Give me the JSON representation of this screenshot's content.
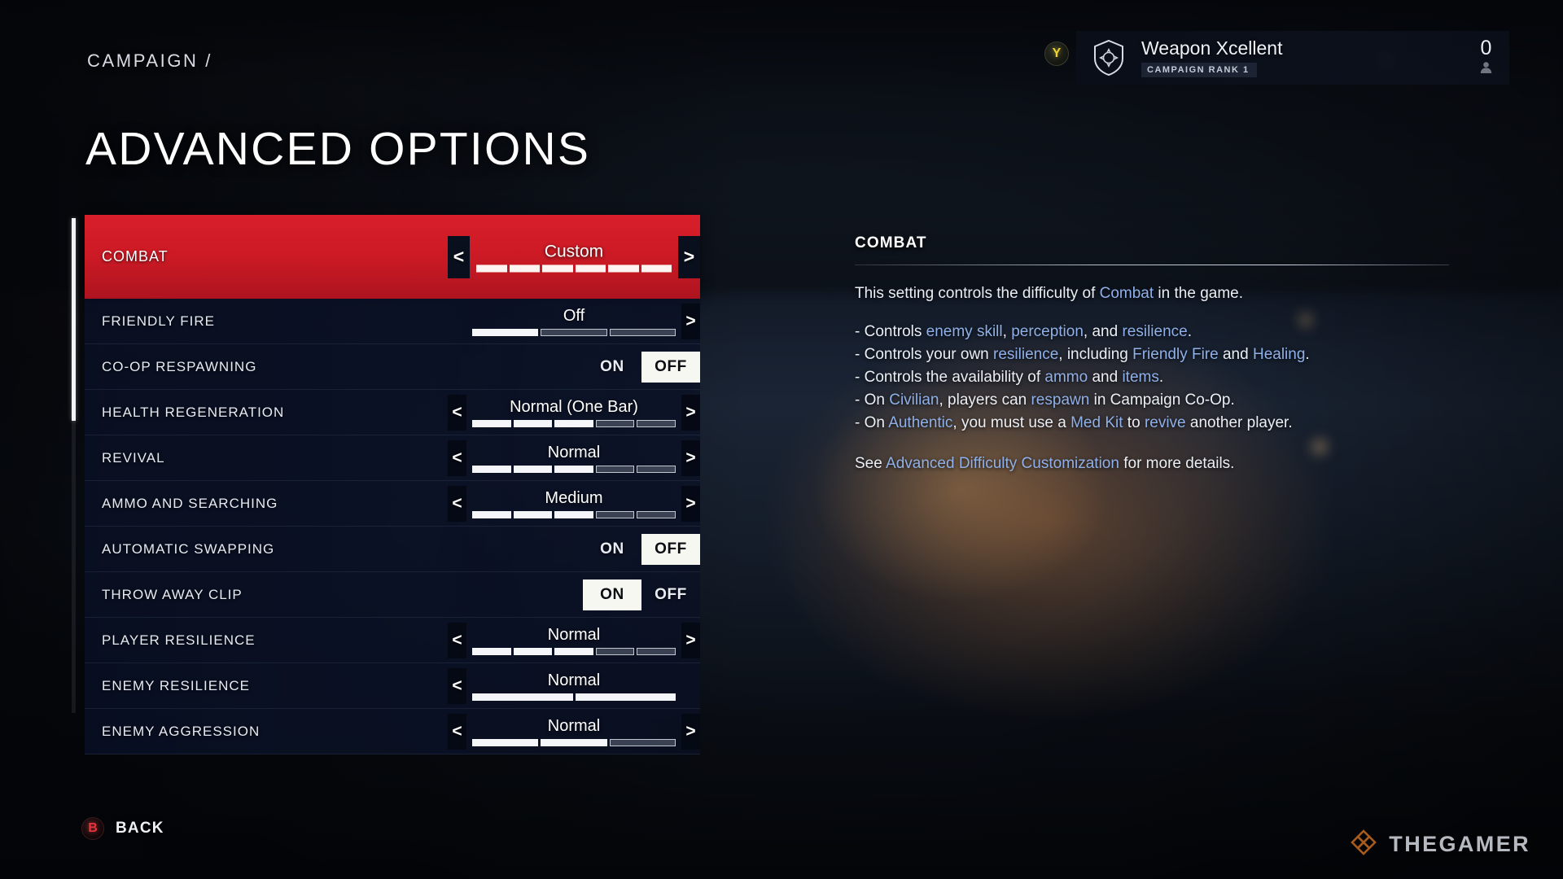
{
  "header": {
    "breadcrumb": "CAMPAIGN /",
    "title": "ADVANCED OPTIONS"
  },
  "player_card": {
    "hint_button": "Y",
    "emblem_icon": "shield-emblem-icon",
    "name": "Weapon Xcellent",
    "rank": "CAMPAIGN RANK 1",
    "count": "0",
    "count_icon": "player-icon"
  },
  "options": {
    "scroll_thumb_pct": 41,
    "rows": [
      {
        "label": "COMBAT",
        "control": "stepper",
        "value": "Custom",
        "segments": 6,
        "filled": 6,
        "left_arrow": "<",
        "right_arrow": ">",
        "show_left": true,
        "show_right": true,
        "selected": true
      },
      {
        "label": "FRIENDLY FIRE",
        "control": "stepper",
        "value": "Off",
        "segments": 3,
        "filled": 1,
        "left_arrow": "<",
        "right_arrow": ">",
        "show_left": false,
        "show_right": true,
        "selected": false
      },
      {
        "label": "CO-OP RESPAWNING",
        "control": "toggle",
        "on_label": "ON",
        "off_label": "OFF",
        "value": "OFF",
        "selected": false
      },
      {
        "label": "HEALTH REGENERATION",
        "control": "stepper",
        "value": "Normal (One Bar)",
        "segments": 5,
        "filled": 3,
        "left_arrow": "<",
        "right_arrow": ">",
        "show_left": true,
        "show_right": true,
        "selected": false
      },
      {
        "label": "REVIVAL",
        "control": "stepper",
        "value": "Normal",
        "segments": 5,
        "filled": 3,
        "left_arrow": "<",
        "right_arrow": ">",
        "show_left": true,
        "show_right": true,
        "selected": false
      },
      {
        "label": "AMMO AND SEARCHING",
        "control": "stepper",
        "value": "Medium",
        "segments": 5,
        "filled": 3,
        "left_arrow": "<",
        "right_arrow": ">",
        "show_left": true,
        "show_right": true,
        "selected": false
      },
      {
        "label": "AUTOMATIC SWAPPING",
        "control": "toggle",
        "on_label": "ON",
        "off_label": "OFF",
        "value": "OFF",
        "selected": false
      },
      {
        "label": "THROW AWAY CLIP",
        "control": "toggle",
        "on_label": "ON",
        "off_label": "OFF",
        "value": "ON",
        "selected": false
      },
      {
        "label": "PLAYER RESILIENCE",
        "control": "stepper",
        "value": "Normal",
        "segments": 5,
        "filled": 3,
        "left_arrow": "<",
        "right_arrow": ">",
        "show_left": true,
        "show_right": true,
        "selected": false
      },
      {
        "label": "ENEMY RESILIENCE",
        "control": "stepper",
        "value": "Normal",
        "segments": 2,
        "filled": 2,
        "left_arrow": "<",
        "right_arrow": ">",
        "show_left": true,
        "show_right": false,
        "selected": false
      },
      {
        "label": "ENEMY AGGRESSION",
        "control": "stepper",
        "value": "Normal",
        "segments": 3,
        "filled": 2,
        "left_arrow": "<",
        "right_arrow": ">",
        "show_left": true,
        "show_right": true,
        "selected": false
      }
    ]
  },
  "info": {
    "title": "COMBAT",
    "intro": [
      {
        "t": "This setting controls the difficulty of ",
        "hl": false
      },
      {
        "t": "Combat",
        "hl": true
      },
      {
        "t": " in the game.",
        "hl": false
      }
    ],
    "bullets": [
      [
        {
          "t": "- Controls ",
          "hl": false
        },
        {
          "t": "enemy skill",
          "hl": true
        },
        {
          "t": ", ",
          "hl": false
        },
        {
          "t": "perception",
          "hl": true
        },
        {
          "t": ", and ",
          "hl": false
        },
        {
          "t": "resilience",
          "hl": true
        },
        {
          "t": ".",
          "hl": false
        }
      ],
      [
        {
          "t": "- Controls your own ",
          "hl": false
        },
        {
          "t": "resilience",
          "hl": true
        },
        {
          "t": ", including ",
          "hl": false
        },
        {
          "t": "Friendly Fire",
          "hl": true
        },
        {
          "t": " and ",
          "hl": false
        },
        {
          "t": "Healing",
          "hl": true
        },
        {
          "t": ".",
          "hl": false
        }
      ],
      [
        {
          "t": "- Controls the availability of ",
          "hl": false
        },
        {
          "t": "ammo",
          "hl": true
        },
        {
          "t": " and ",
          "hl": false
        },
        {
          "t": "items",
          "hl": true
        },
        {
          "t": ".",
          "hl": false
        }
      ],
      [
        {
          "t": "- On ",
          "hl": false
        },
        {
          "t": "Civilian",
          "hl": true
        },
        {
          "t": ", players can ",
          "hl": false
        },
        {
          "t": "respawn",
          "hl": true
        },
        {
          "t": " in Campaign Co-Op.",
          "hl": false
        }
      ],
      [
        {
          "t": "- On ",
          "hl": false
        },
        {
          "t": "Authentic",
          "hl": true
        },
        {
          "t": ", you must use a ",
          "hl": false
        },
        {
          "t": "Med Kit",
          "hl": true
        },
        {
          "t": " to ",
          "hl": false
        },
        {
          "t": "revive",
          "hl": true
        },
        {
          "t": " another player.",
          "hl": false
        }
      ]
    ],
    "footer": [
      {
        "t": "See ",
        "hl": false
      },
      {
        "t": "Advanced Difficulty Customization",
        "hl": true
      },
      {
        "t": " for more details.",
        "hl": false
      }
    ]
  },
  "footer": {
    "back_button_glyph": "B",
    "back_label": "BACK",
    "watermark_text": "THEGAMER",
    "watermark_icon": "thegamer-logo-icon"
  },
  "colors": {
    "accent_red": "#cc1a25",
    "panel_navy": "#0a1126",
    "highlight_blue": "#8fb0e8",
    "toggle_active_bg": "#f7f7f2",
    "yellow_button": "#f2d431"
  }
}
